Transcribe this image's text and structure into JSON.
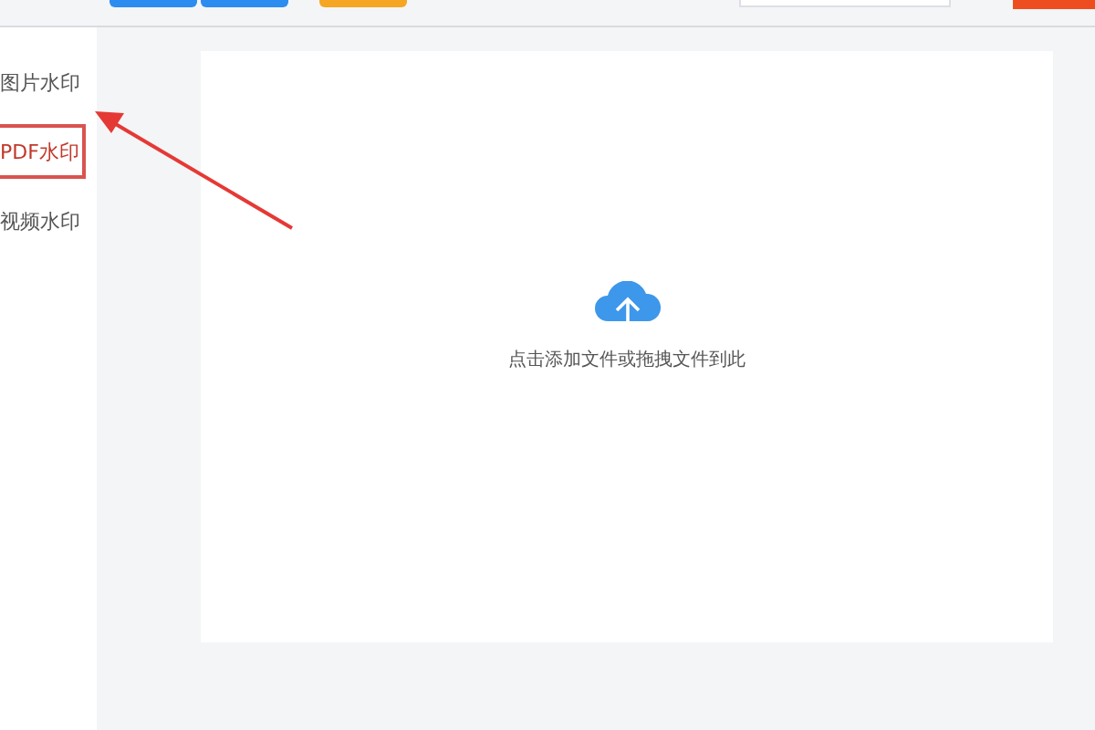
{
  "toolbar": {
    "buttons": [
      {
        "kind": "primary"
      },
      {
        "kind": "primary"
      },
      {
        "kind": "warning"
      }
    ],
    "search_field": {
      "kind": "input"
    },
    "action_button": {
      "kind": "danger"
    }
  },
  "sidebar": {
    "items": [
      {
        "label": "图片水印",
        "selected": false
      },
      {
        "label": "PDF水印",
        "selected": true
      },
      {
        "label": "视频水印",
        "selected": false
      }
    ]
  },
  "upload": {
    "hint": "点击添加文件或拖拽文件到此"
  },
  "annotation": {
    "kind": "arrow"
  }
}
